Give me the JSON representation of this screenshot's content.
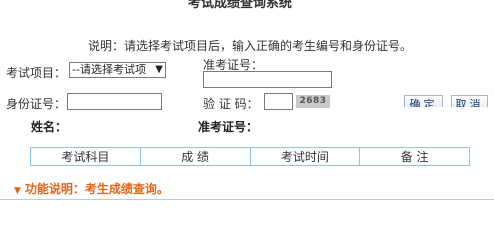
{
  "title": "考试成绩查询系统",
  "instruction": "说明：请选择考试项目后，输入正确的考生编号和身份证号。",
  "form": {
    "exam_label": "考试项目：",
    "exam_selected": "--请选择考试项",
    "admission_label": "准考证号：",
    "admission_value": "",
    "id_label": "身份证号：",
    "id_value": "",
    "captcha_label": "验 证 码：",
    "captcha_value": "",
    "captcha_code": "2683",
    "confirm_label": "确定",
    "cancel_label": "取消"
  },
  "result": {
    "name_label": "姓名：",
    "admission_label": "准考证号："
  },
  "table": {
    "headers": [
      "考试科目",
      "成 绩",
      "考试时间",
      "备 注"
    ]
  },
  "footer": {
    "icon": "down-triangle-icon",
    "text": "功能说明：考生成绩查询。"
  },
  "colors": {
    "accent": "#e2661a",
    "table_border": "#8fc3ea"
  }
}
